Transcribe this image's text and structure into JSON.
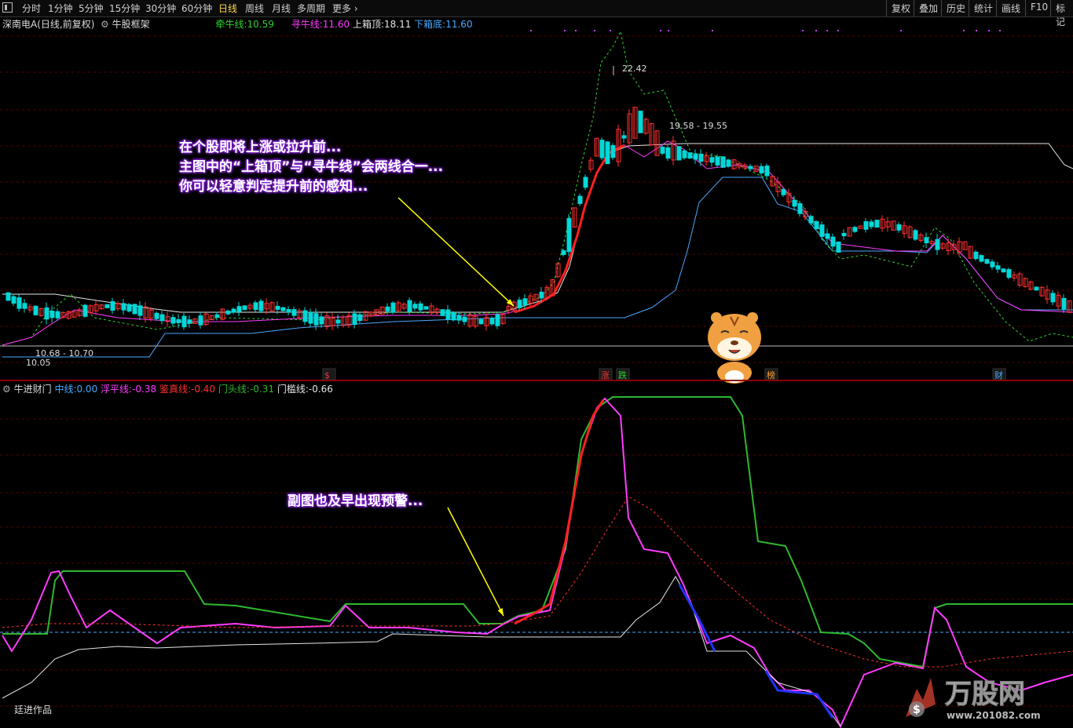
{
  "toolbar": {
    "periods": [
      "分时",
      "1分钟",
      "5分钟",
      "15分钟",
      "30分钟",
      "60分钟",
      "日线",
      "周线",
      "月线",
      "多周期",
      "更多"
    ],
    "active_period": "日线",
    "right_buttons": [
      "复权",
      "叠加",
      "历史",
      "统计",
      "画线",
      "F10",
      "标记"
    ]
  },
  "main_legend": {
    "stock": "深南电A(日线,前复权)",
    "indicator": "牛股框架",
    "items": [
      {
        "label": "牵牛线:",
        "value": "10.59",
        "color": "#2fd12f"
      },
      {
        "label": "寻牛线:",
        "value": "11.60",
        "color": "#ff3cff"
      },
      {
        "label": "上箱顶:",
        "value": "18.11",
        "color": "#e6e6e6"
      },
      {
        "label": "下箱底:",
        "value": "11.60",
        "color": "#4aa8ff"
      }
    ]
  },
  "sub_legend": {
    "indicator": "牛进财门",
    "items": [
      {
        "label": "中线:",
        "value": "0.00",
        "color": "#4aa8ff"
      },
      {
        "label": "浮平线:",
        "value": "-0.38",
        "color": "#ff3cff"
      },
      {
        "label": "鉴真线:",
        "value": "-0.40",
        "color": "#ff3030"
      },
      {
        "label": "门头线:",
        "value": "-0.31",
        "color": "#2fb82f"
      },
      {
        "label": "门槛线:",
        "value": "-0.66",
        "color": "#e6e6e6"
      }
    ]
  },
  "price_labels": {
    "high": "22.42",
    "box_high": "19.58 - 19.55",
    "box_low": "10.68 - 10.70",
    "low": "10.05"
  },
  "event_markers": [
    {
      "text": "$",
      "color": "#ff3030"
    },
    {
      "text": "涨",
      "color": "#ff3030"
    },
    {
      "text": "跌",
      "color": "#2fd12f"
    },
    {
      "text": "榜",
      "color": "#ffa030"
    },
    {
      "text": "财",
      "color": "#4aa8ff"
    }
  ],
  "annotations": {
    "main_lines": [
      "在个股即将上涨或拉升前...",
      "主图中的“上箱顶”与“寻牛线”会两线合一...",
      "你可以轻意判定提升前的感知..."
    ],
    "sub_line": "副图也及早出现预警..."
  },
  "footer_label": "廷进作品",
  "watermark": {
    "text": "万股网",
    "url": "www.201082.com"
  },
  "colors": {
    "up": "#ff3030",
    "down": "#00d8d8",
    "grid": "#5a0000",
    "qianniu": "#2fd12f",
    "xunniu": "#ff3cff",
    "box_top": "#e6e6e6",
    "box_bottom": "#4aa8ff"
  }
}
